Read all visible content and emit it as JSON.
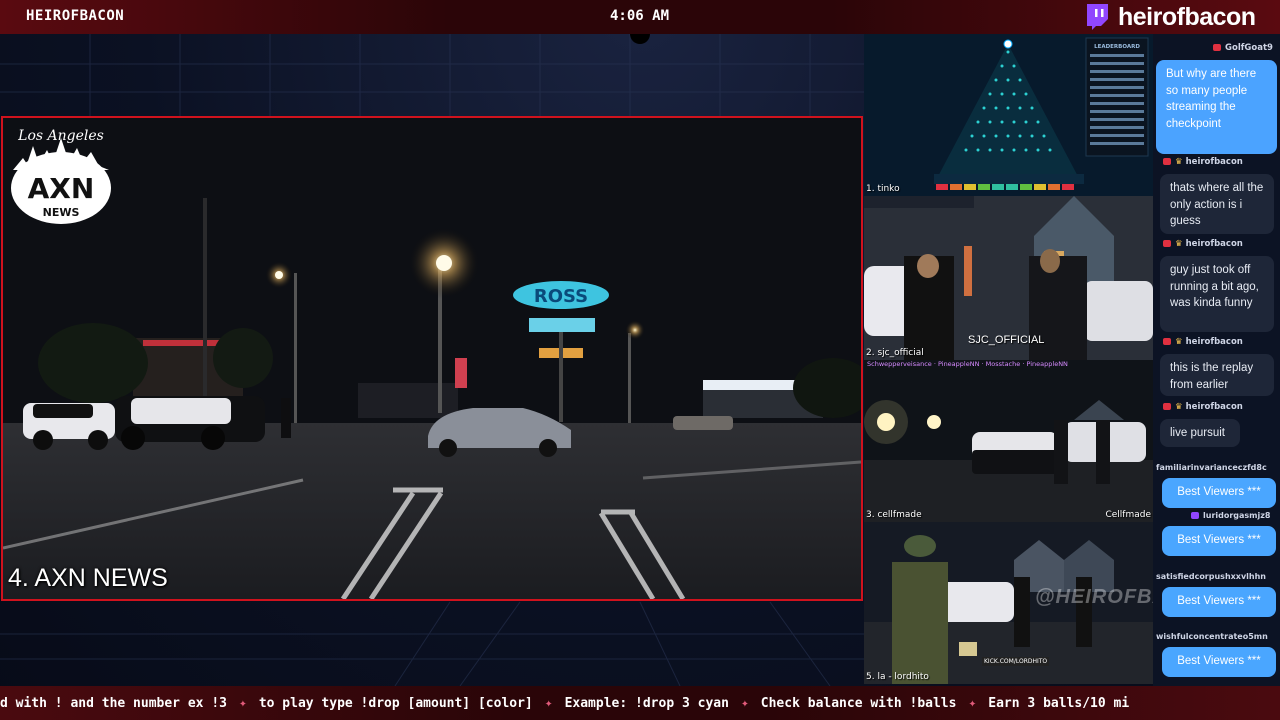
{
  "topbar": {
    "channel_name": "HEIROFBACON",
    "clock": "4:06 AM",
    "brand_handle": "heirofbacon"
  },
  "main_stream": {
    "label": "4. AXN NEWS",
    "logo_top": "Los Angeles",
    "logo_main": "AXN",
    "logo_sub": "NEWS",
    "sign_text": "ROSS"
  },
  "streams": [
    {
      "label": "1. tinko",
      "overlay_title": "LEADERBOARD"
    },
    {
      "label": "2. sjc_official",
      "overlay_tag": "SJC_OFFICIAL"
    },
    {
      "label": "3. cellfmade",
      "overlay_tag": "Cellfmade",
      "chat_names": [
        "Schwepperveisance",
        "PineappleNN",
        "Mosstache",
        "PineappleNN"
      ]
    },
    {
      "label": "5. la - lordhito",
      "overlay_tag": "KICK.COM/LORDHITO"
    }
  ],
  "watermark": "@HEIROFBACON",
  "chat": {
    "messages": [
      {
        "user": "GolfGoat9",
        "text": "But why are there so many people streaming the checkpoint",
        "style": "blue"
      },
      {
        "user": "heirofbacon",
        "text": "thats where all the only action is i guess",
        "style": "dark"
      },
      {
        "user": "heirofbacon",
        "text": "guy just took off running a bit ago, was kinda funny",
        "style": "dark"
      },
      {
        "user": "heirofbacon",
        "text": "this is the replay from earlier",
        "style": "dark"
      },
      {
        "user": "heirofbacon",
        "text": "live pursuit",
        "style": "dark"
      },
      {
        "user": "familiarinvarianceczfd8c",
        "text": "Best Viewers ***",
        "style": "view"
      },
      {
        "user": "luridorgasmjz8",
        "text": "Best Viewers ***",
        "style": "view"
      },
      {
        "user": "satisfiedcorpushxxvlhhn",
        "text": "Best Viewers ***",
        "style": "view"
      },
      {
        "user": "wishfulconcentrateo5mn",
        "text": "Best Viewers ***",
        "style": "view"
      }
    ]
  },
  "ticker": {
    "segments": [
      "d with ! and the number ex !3",
      "to play type !drop [amount] [color]",
      "Example: !drop 3 cyan",
      "Check balance with !balls",
      "Earn 3 balls/10 mi"
    ]
  },
  "colors": {
    "accent_red": "#d0121d",
    "chat_blue": "#4ba3ff",
    "twitch_purple": "#9146ff"
  }
}
